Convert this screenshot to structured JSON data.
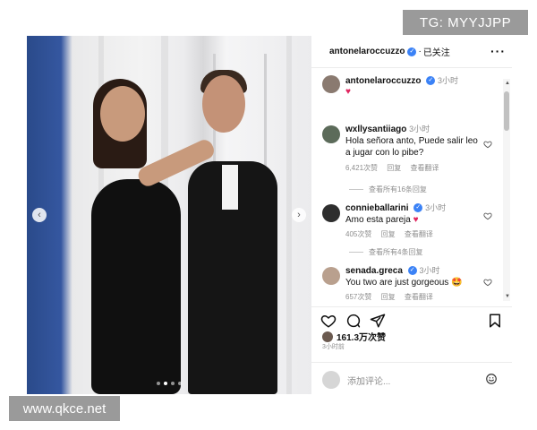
{
  "watermarks": {
    "top": "TG: MYYJJPP",
    "bottom": "www.qkce.net"
  },
  "post": {
    "author": "antonelaroccuzzo",
    "follow_separator": "·",
    "follow_status": "已关注",
    "more_icon": "more-horizontal-icon",
    "caption_author": "antonelaroccuzzo",
    "caption_time": "3小时",
    "caption_emoji": "♥",
    "likes": "161.3万次赞",
    "time_ago": "3小时前",
    "carousel": {
      "slides": 4,
      "active_index": 1
    },
    "input_placeholder": "添加评论..."
  },
  "comments": [
    {
      "user": "wxllysantiiago",
      "time": "3小时",
      "text": "Hola señora anto, Puede salir leo a jugar con lo pibe?",
      "likes": "6,421次赞",
      "reply": "回复",
      "translate": "查看翻译",
      "view_replies": "查看所有16条回复"
    },
    {
      "user": "connieballarini",
      "time": "3小时",
      "text": "Amo esta pareja",
      "emoji": "♥",
      "likes": "405次赞",
      "reply": "回复",
      "translate": "查看翻译",
      "view_replies": "查看所有4条回复"
    },
    {
      "user": "senada.greca",
      "time": "3小时",
      "text": "You two are just gorgeous",
      "emoji": "🤩",
      "likes": "657次赞",
      "reply": "回复",
      "translate": "查看翻译"
    }
  ],
  "colors": {
    "verified": "#3b82f6",
    "heart": "#e0245e",
    "muted": "#8e8e8e"
  }
}
